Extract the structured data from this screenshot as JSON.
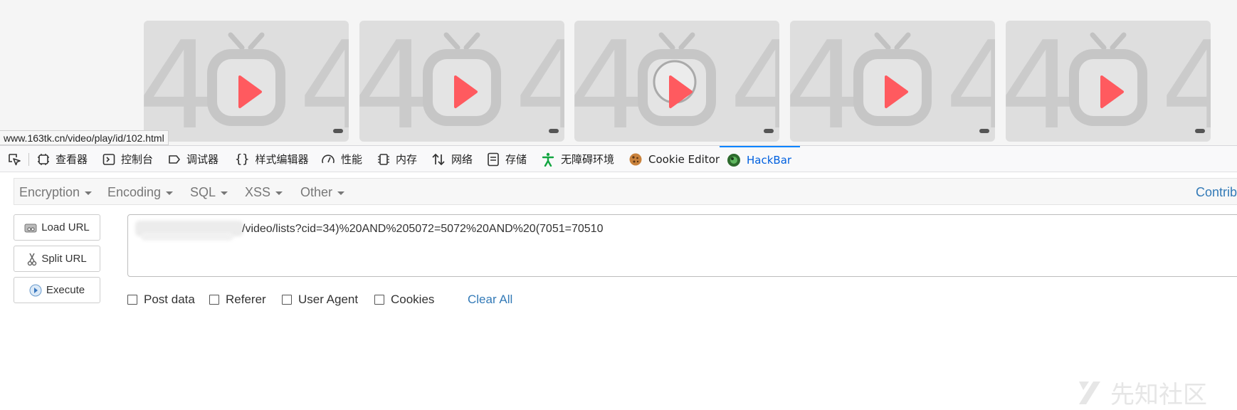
{
  "thumbnails": [
    {
      "label": "404",
      "icon": "tv-play-icon"
    },
    {
      "label": "404",
      "icon": "tv-play-icon"
    },
    {
      "label": "404",
      "icon": "tv-play-icon"
    },
    {
      "label": "404",
      "icon": "tv-play-icon"
    },
    {
      "label": "404",
      "icon": "tv-play-icon"
    }
  ],
  "status_url": "www.163tk.cn/video/play/id/102.html",
  "devtools": {
    "tabs": [
      {
        "label": "查看器",
        "icon": "inspector-icon"
      },
      {
        "label": "控制台",
        "icon": "console-icon"
      },
      {
        "label": "调试器",
        "icon": "debugger-icon"
      },
      {
        "label": "样式编辑器",
        "icon": "style-editor-icon"
      },
      {
        "label": "性能",
        "icon": "performance-icon"
      },
      {
        "label": "内存",
        "icon": "memory-icon"
      },
      {
        "label": "网络",
        "icon": "network-icon"
      },
      {
        "label": "存储",
        "icon": "storage-icon"
      },
      {
        "label": "无障碍环境",
        "icon": "accessibility-icon"
      },
      {
        "label": "Cookie Editor",
        "icon": "cookie-icon"
      },
      {
        "label": "HackBar",
        "icon": "hackbar-icon"
      }
    ],
    "active_tab": "HackBar"
  },
  "hackbar": {
    "menu": [
      "Encryption",
      "Encoding",
      "SQL",
      "XSS",
      "Other"
    ],
    "contrib": "Contrib",
    "buttons": {
      "load": "Load URL",
      "split": "Split URL",
      "execute": "Execute"
    },
    "url_value": "/video/lists?cid=34)%20AND%205072=5072%20AND%20(7051=70510",
    "checkboxes": [
      "Post data",
      "Referer",
      "User Agent",
      "Cookies"
    ],
    "clear_all": "Clear All"
  },
  "watermark": "先知社区",
  "colors": {
    "link": "#337ab7",
    "active_tab": "#0060df",
    "play": "#ff5a5f"
  }
}
